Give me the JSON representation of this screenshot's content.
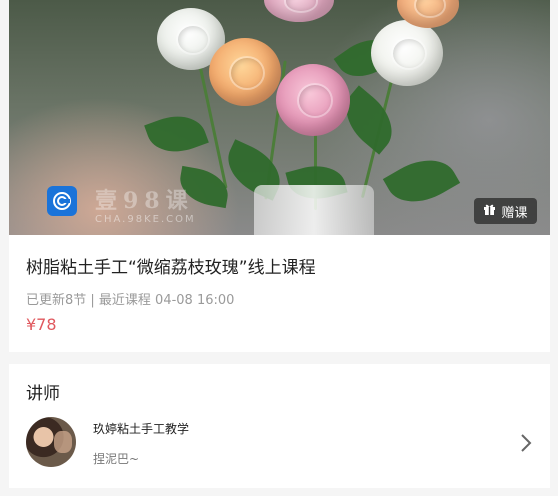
{
  "hero": {
    "watermark_main": "壹98课",
    "watermark_sub": "CHA.98KE.COM",
    "gift_label": "赠课",
    "icons": {
      "logo": "c-logo-icon",
      "gift": "gift-icon"
    },
    "colors": {
      "logo_bg": "#1a73d9"
    }
  },
  "course": {
    "title": "树脂粘土手工“微缩荔枝玫瑰”线上课程",
    "meta": "已更新8节 | 最近课程 04-08 16:00",
    "price": "¥78",
    "colors": {
      "price": "#e0585e"
    }
  },
  "teacher_section": {
    "title": "讲师",
    "teacher": {
      "name": "玖婷粘土手工教学",
      "subtitle": "捏泥巴~",
      "icon": "chevron-right-icon"
    }
  }
}
